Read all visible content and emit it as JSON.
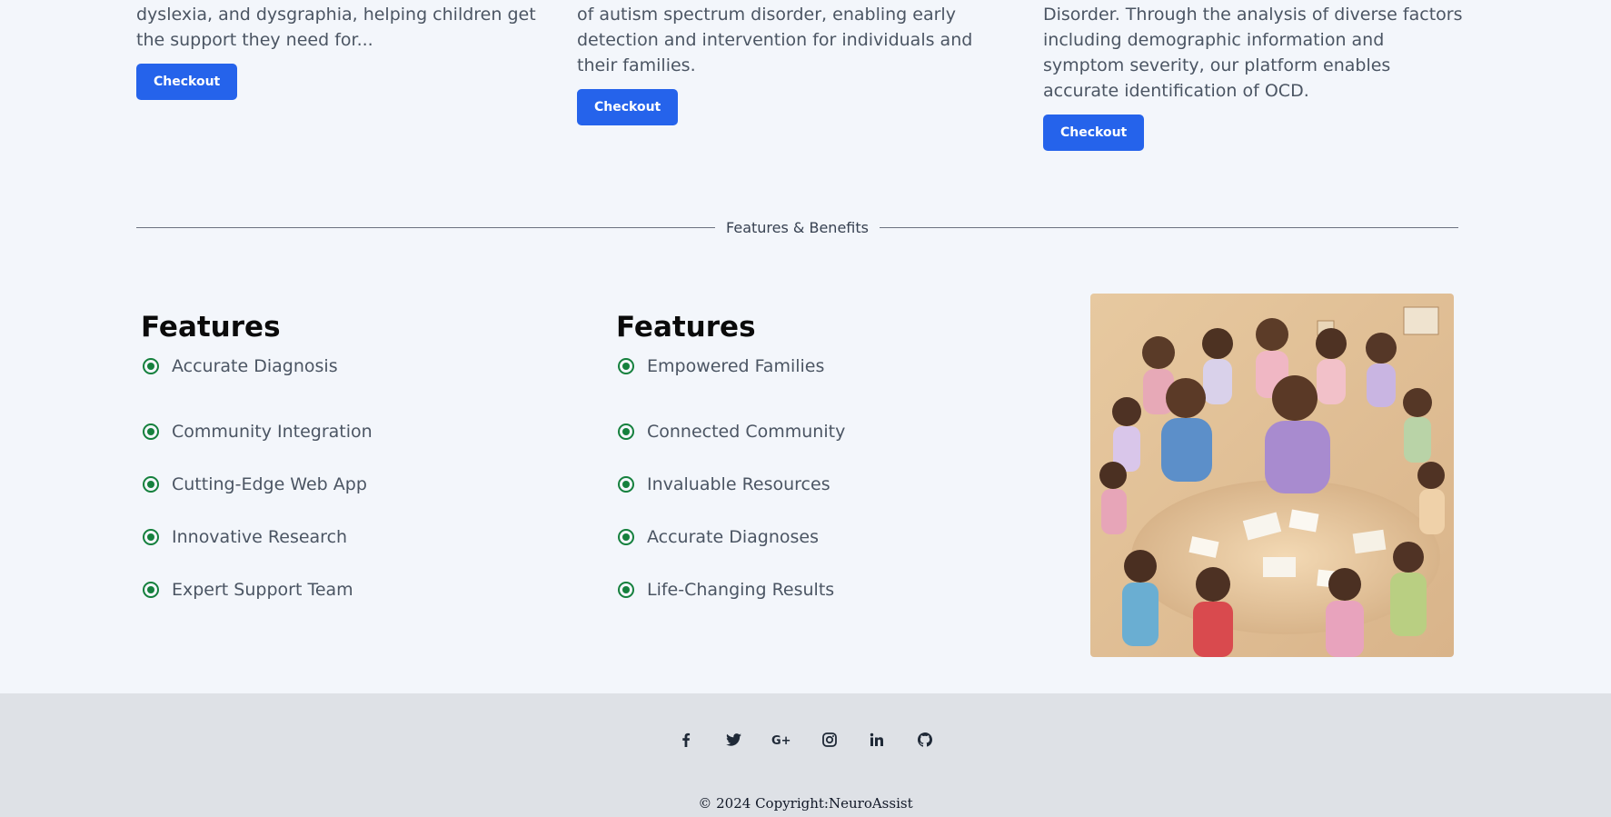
{
  "cards": [
    {
      "text": "dyslexia, and dysgraphia, helping children get the support they need for...",
      "button": "Checkout"
    },
    {
      "text": "of autism spectrum disorder, enabling early detection and intervention for individuals and their families.",
      "button": "Checkout"
    },
    {
      "text": "Disorder. Through the analysis of diverse factors including demographic information and symptom severity, our platform enables accurate identification of OCD.",
      "button": "Checkout"
    }
  ],
  "section_label": "Features & Benefits",
  "features_left": {
    "title": "Features",
    "items": [
      "Accurate Diagnosis",
      "Community Integration",
      "Cutting-Edge Web App",
      "Innovative Research",
      "Expert Support Team"
    ]
  },
  "features_right": {
    "title": "Features",
    "items": [
      "Empowered Families",
      "Connected Community",
      "Invaluable Resources",
      "Accurate Diagnoses",
      "Life-Changing Results"
    ]
  },
  "footer": {
    "social_icons": [
      "facebook-icon",
      "twitter-icon",
      "google-plus-icon",
      "instagram-icon",
      "linkedin-icon",
      "github-icon"
    ],
    "copyright": "© 2024 Copyright:NeuroAssist"
  },
  "colors": {
    "accent": "#2563eb",
    "bullet": "#15803d",
    "page_bg": "#f3f6fb",
    "footer_bg": "#dee1e6"
  }
}
